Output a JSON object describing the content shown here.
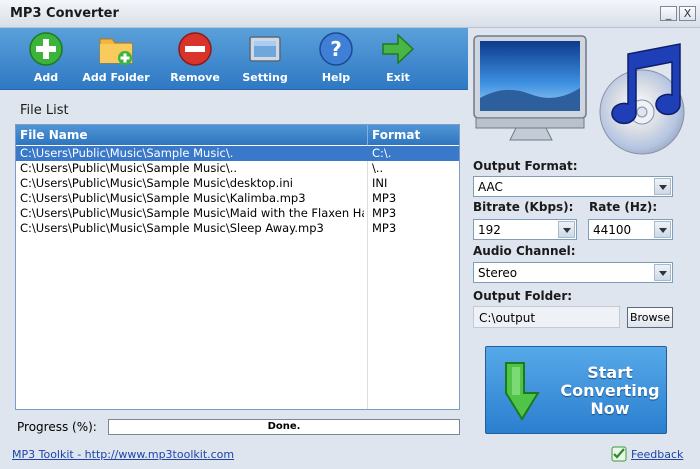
{
  "window": {
    "title": "MP3 Converter",
    "minimize_glyph": "_",
    "close_glyph": "X"
  },
  "toolbar": {
    "items": [
      {
        "label": "Add",
        "icon": "add-icon"
      },
      {
        "label": "Add Folder",
        "icon": "add-folder-icon"
      },
      {
        "label": "Remove",
        "icon": "remove-icon"
      },
      {
        "label": "Setting",
        "icon": "setting-icon"
      },
      {
        "label": "Help",
        "icon": "help-icon"
      },
      {
        "label": "Exit",
        "icon": "exit-icon"
      }
    ]
  },
  "file_list": {
    "title": "File List",
    "columns": [
      "File Name",
      "Format"
    ],
    "rows": [
      {
        "name": "C:\\Users\\Public\\Music\\Sample Music\\.",
        "format": "C:\\.",
        "selected": true
      },
      {
        "name": "C:\\Users\\Public\\Music\\Sample Music\\..",
        "format": "\\..",
        "selected": false
      },
      {
        "name": "C:\\Users\\Public\\Music\\Sample Music\\desktop.ini",
        "format": "INI",
        "selected": false
      },
      {
        "name": "C:\\Users\\Public\\Music\\Sample Music\\Kalimba.mp3",
        "format": "MP3",
        "selected": false
      },
      {
        "name": "C:\\Users\\Public\\Music\\Sample Music\\Maid with the Flaxen Hair....",
        "format": "MP3",
        "selected": false
      },
      {
        "name": "C:\\Users\\Public\\Music\\Sample Music\\Sleep Away.mp3",
        "format": "MP3",
        "selected": false
      }
    ]
  },
  "progress": {
    "label": "Progress (%):",
    "status": "Done."
  },
  "settings": {
    "output_format": {
      "label": "Output Format:",
      "value": "AAC"
    },
    "bitrate": {
      "label": "Bitrate (Kbps):",
      "value": "192"
    },
    "rate": {
      "label": "Rate (Hz):",
      "value": "44100"
    },
    "audio_channel": {
      "label": "Audio Channel:",
      "value": "Stereo"
    },
    "output_folder": {
      "label": "Output Folder:",
      "value": "C:\\output",
      "browse_label": "Browse"
    }
  },
  "start": {
    "line1": "Start",
    "line2": "Converting",
    "line3": "Now"
  },
  "footer": {
    "link": "MP3 Toolkit - http://www.mp3toolkit.com",
    "feedback": "Feedback"
  },
  "colors": {
    "toolbar": "#3a86cc",
    "selection": "#3a78c9",
    "start_button": "#3e93db"
  }
}
